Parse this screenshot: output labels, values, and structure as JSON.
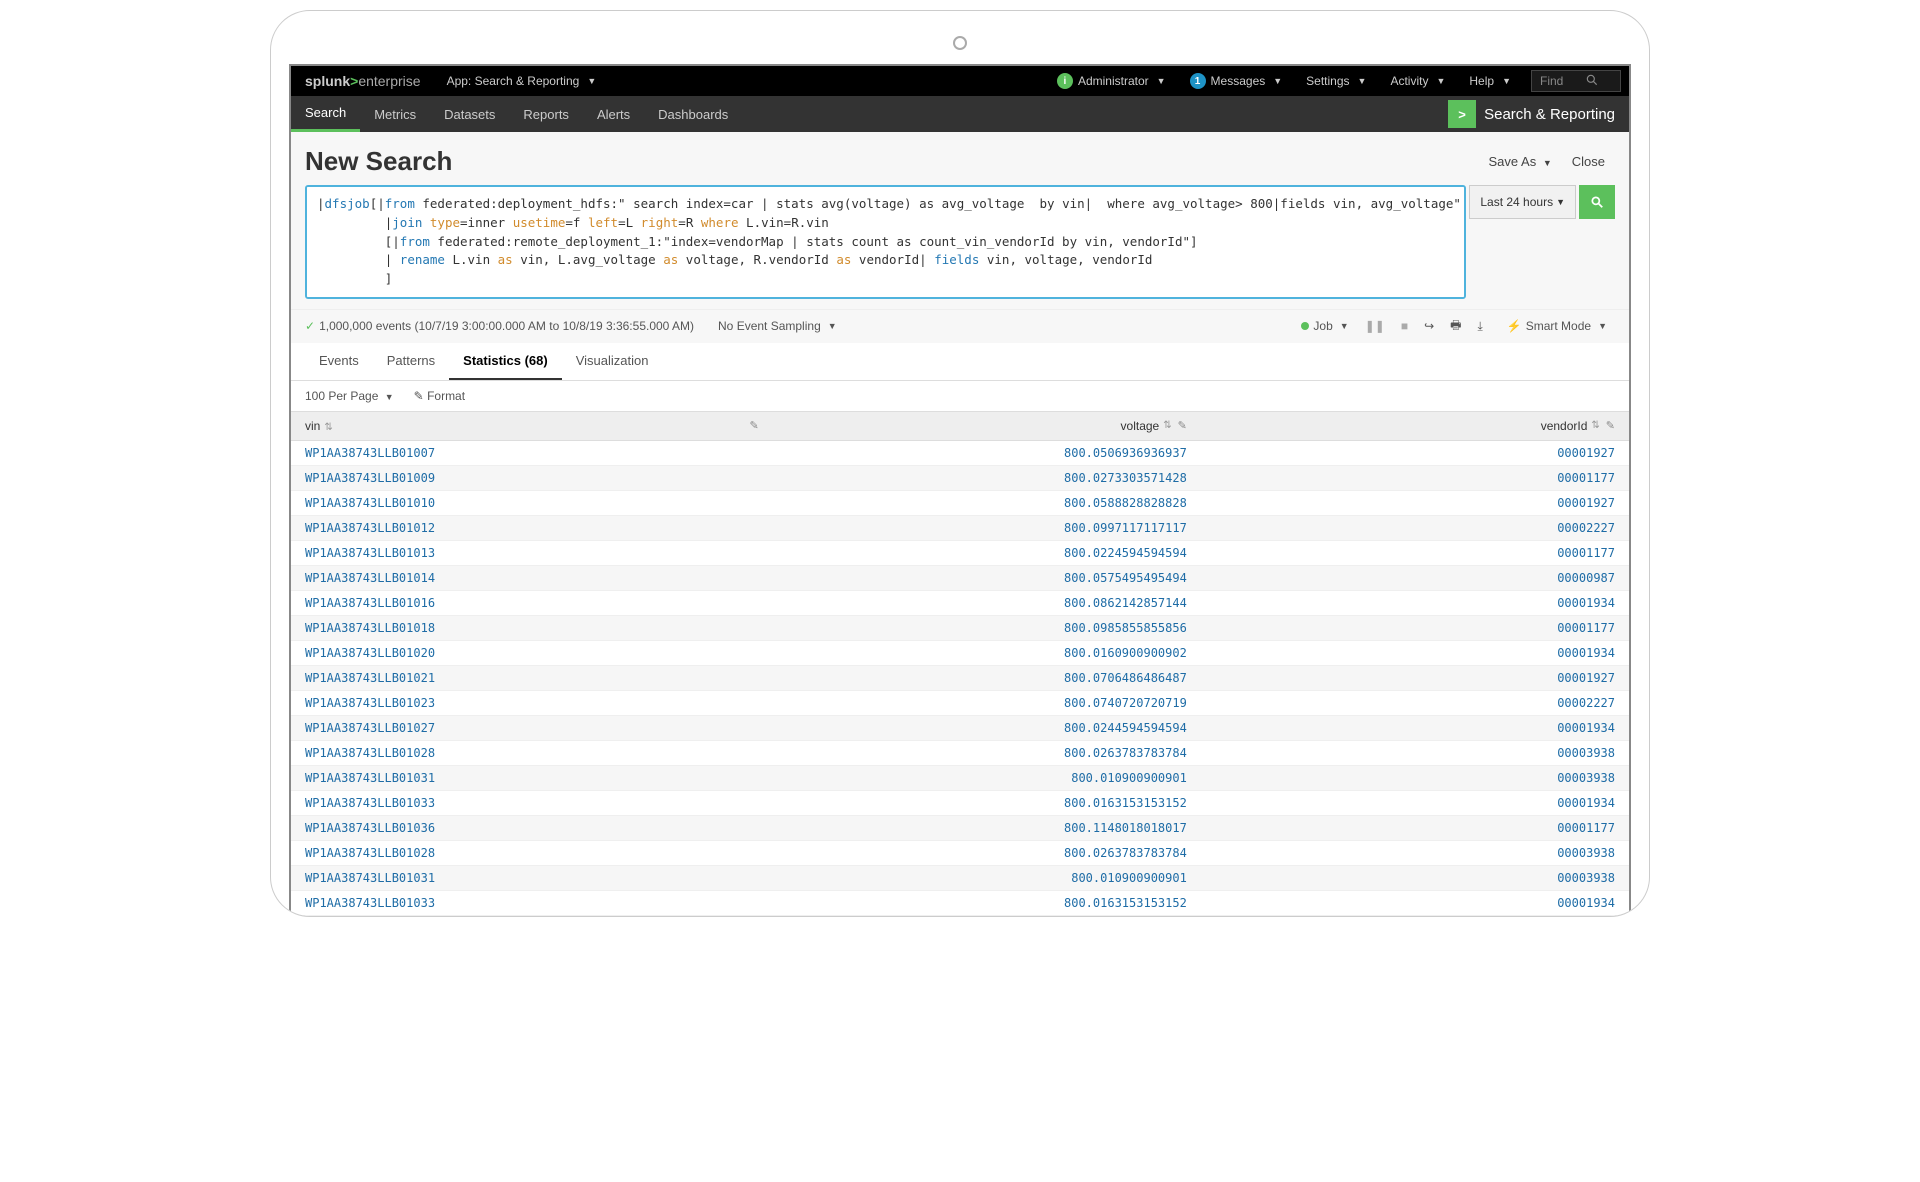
{
  "topbar": {
    "brand_left": "splunk",
    "brand_right": "enterprise",
    "app_label": "App: Search & Reporting",
    "admin": "Administrator",
    "messages": "Messages",
    "messages_badge": "1",
    "settings": "Settings",
    "activity": "Activity",
    "help": "Help",
    "find_placeholder": "Find"
  },
  "nav": {
    "items": [
      "Search",
      "Metrics",
      "Datasets",
      "Reports",
      "Alerts",
      "Dashboards"
    ],
    "app_name": "Search & Reporting"
  },
  "header": {
    "title": "New Search",
    "save_as": "Save As",
    "close": "Close"
  },
  "search": {
    "time_label": "Last 24 hours"
  },
  "query": {
    "l1a": "|",
    "l1b": "dfsjob",
    "l1c": "[|",
    "l1d": "from",
    "l1e": " federated:deployment_hdfs:\" search index=car | stats avg(voltage) as avg_voltage  by vin|  where avg_voltage> 800|fields vin, avg_voltage\"",
    "l2a": "         |",
    "l2b": "join",
    "l2c": " ",
    "l2d": "type",
    "l2e": "=inner ",
    "l2f": "usetime",
    "l2g": "=f ",
    "l2h": "left",
    "l2i": "=L ",
    "l2j": "right",
    "l2k": "=R ",
    "l2l": "where",
    "l2m": " L.vin=R.vin",
    "l3a": "         [|",
    "l3b": "from",
    "l3c": " federated:remote_deployment_1:\"index=vendorMap | stats count as count_vin_vendorId by vin, vendorId\"]",
    "l4a": "         | ",
    "l4b": "rename",
    "l4c": " L.vin ",
    "l4d": "as",
    "l4e": " vin, L.avg_voltage ",
    "l4f": "as",
    "l4g": " voltage, R.vendorId ",
    "l4h": "as",
    "l4i": " vendorId| ",
    "l4j": "fields",
    "l4k": " vin, voltage, vendorId",
    "l5a": "         ]"
  },
  "info": {
    "events_text": "1,000,000 events (10/7/19 3:00:00.000 AM to 10/8/19 3:36:55.000 AM)",
    "sampling": "No Event Sampling",
    "job": "Job",
    "smart_mode": "Smart Mode"
  },
  "tabs": {
    "events": "Events",
    "patterns": "Patterns",
    "stats": "Statistics (68)",
    "viz": "Visualization"
  },
  "controls": {
    "per_page": "100 Per Page",
    "format": "Format"
  },
  "table": {
    "columns": {
      "vin": "vin",
      "voltage": "voltage",
      "vendorId": "vendorId"
    },
    "rows": [
      {
        "vin": "WP1AA38743LLB01007",
        "voltage": "800.0506936936937",
        "vendorId": "00001927"
      },
      {
        "vin": "WP1AA38743LLB01009",
        "voltage": "800.0273303571428",
        "vendorId": "00001177"
      },
      {
        "vin": "WP1AA38743LLB01010",
        "voltage": "800.0588828828828",
        "vendorId": "00001927"
      },
      {
        "vin": "WP1AA38743LLB01012",
        "voltage": "800.0997117117117",
        "vendorId": "00002227"
      },
      {
        "vin": "WP1AA38743LLB01013",
        "voltage": "800.0224594594594",
        "vendorId": "00001177"
      },
      {
        "vin": "WP1AA38743LLB01014",
        "voltage": "800.0575495495494",
        "vendorId": "00000987"
      },
      {
        "vin": "WP1AA38743LLB01016",
        "voltage": "800.0862142857144",
        "vendorId": "00001934"
      },
      {
        "vin": "WP1AA38743LLB01018",
        "voltage": "800.0985855855856",
        "vendorId": "00001177"
      },
      {
        "vin": "WP1AA38743LLB01020",
        "voltage": "800.0160900900902",
        "vendorId": "00001934"
      },
      {
        "vin": "WP1AA38743LLB01021",
        "voltage": "800.0706486486487",
        "vendorId": "00001927"
      },
      {
        "vin": "WP1AA38743LLB01023",
        "voltage": "800.0740720720719",
        "vendorId": "00002227"
      },
      {
        "vin": "WP1AA38743LLB01027",
        "voltage": "800.0244594594594",
        "vendorId": "00001934"
      },
      {
        "vin": "WP1AA38743LLB01028",
        "voltage": "800.0263783783784",
        "vendorId": "00003938"
      },
      {
        "vin": "WP1AA38743LLB01031",
        "voltage": "800.010900900901",
        "vendorId": "00003938"
      },
      {
        "vin": "WP1AA38743LLB01033",
        "voltage": "800.0163153153152",
        "vendorId": "00001934"
      },
      {
        "vin": "WP1AA38743LLB01036",
        "voltage": "800.1148018018017",
        "vendorId": "00001177"
      },
      {
        "vin": "WP1AA38743LLB01028",
        "voltage": "800.0263783783784",
        "vendorId": "00003938"
      },
      {
        "vin": "WP1AA38743LLB01031",
        "voltage": "800.010900900901",
        "vendorId": "00003938"
      },
      {
        "vin": "WP1AA38743LLB01033",
        "voltage": "800.0163153153152",
        "vendorId": "00001934"
      }
    ]
  }
}
